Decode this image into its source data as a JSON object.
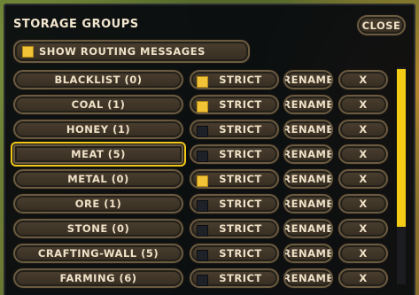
{
  "window": {
    "title": "STORAGE GROUPS",
    "close_label": "CLOSE"
  },
  "routing": {
    "label": "SHOW ROUTING MESSAGES",
    "checked": true
  },
  "strict_label": "STRICT",
  "rename_label": "RENAME",
  "remove_label": "X",
  "groups": [
    {
      "name": "BLACKLIST (0)",
      "strict": true,
      "selected": false
    },
    {
      "name": "COAL (1)",
      "strict": true,
      "selected": false
    },
    {
      "name": "HONEY (1)",
      "strict": false,
      "selected": false
    },
    {
      "name": "MEAT (5)",
      "strict": false,
      "selected": true
    },
    {
      "name": "METAL (0)",
      "strict": true,
      "selected": false
    },
    {
      "name": "ORE (1)",
      "strict": false,
      "selected": false
    },
    {
      "name": "STONE (0)",
      "strict": false,
      "selected": false
    },
    {
      "name": "CRAFTING-WALL (5)",
      "strict": false,
      "selected": false
    },
    {
      "name": "FARMING (6)",
      "strict": false,
      "selected": false
    }
  ],
  "scrollbar": {
    "visible_fraction": 0.73,
    "position": 0.0
  },
  "colors": {
    "accent": "#f4cc16",
    "panel": "#06090e",
    "button": "#3e3428",
    "text": "#f0e2c8"
  }
}
